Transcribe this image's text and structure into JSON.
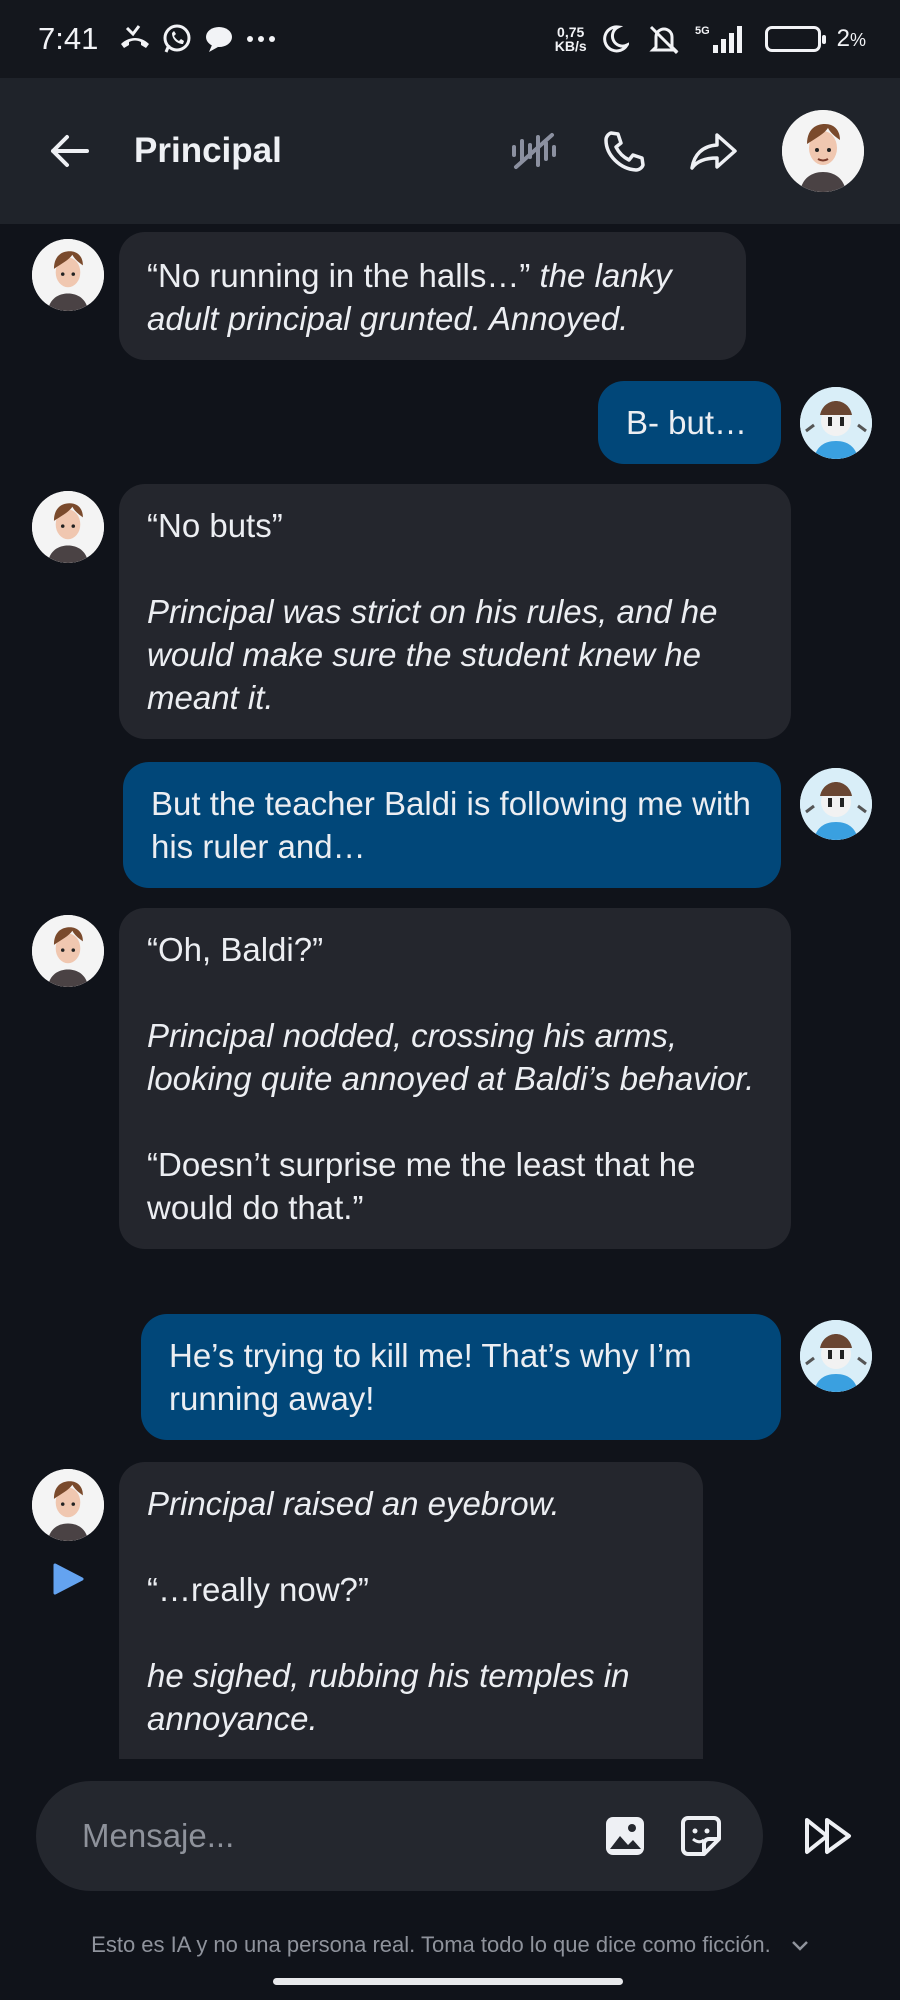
{
  "status_bar": {
    "time": "7:41",
    "icons_left": [
      "missed-call-icon",
      "whatsapp-icon",
      "chat-bubble-icon",
      "more-dots-icon"
    ],
    "speed_value": "0,75",
    "speed_unit": "KB/s",
    "network": "5G",
    "battery": "2",
    "battery_unit": "%"
  },
  "header": {
    "back_icon": "arrow-left-icon",
    "title": "Principal",
    "actions": [
      "voice-off-icon",
      "phone-icon",
      "share-icon"
    ]
  },
  "messages": [
    {
      "sender": "ai",
      "paragraphs": [
        {
          "runs": [
            {
              "text": "“No running in the halls…” ",
              "italic": false
            },
            {
              "text": "the lanky adult principal grunted. Annoyed.",
              "italic": true
            }
          ]
        }
      ]
    },
    {
      "sender": "user",
      "paragraphs": [
        {
          "runs": [
            {
              "text": "B- but…",
              "italic": false
            }
          ]
        }
      ]
    },
    {
      "sender": "ai",
      "paragraphs": [
        {
          "runs": [
            {
              "text": "“No buts”",
              "italic": false
            }
          ]
        },
        {
          "runs": [
            {
              "text": "Principal was strict on his rules, and he would make sure the student knew he meant it.",
              "italic": true
            }
          ]
        }
      ]
    },
    {
      "sender": "user",
      "paragraphs": [
        {
          "runs": [
            {
              "text": "But the teacher Baldi is following me with his ruler and…",
              "italic": false
            }
          ]
        }
      ]
    },
    {
      "sender": "ai",
      "paragraphs": [
        {
          "runs": [
            {
              "text": "“Oh, Baldi?”",
              "italic": false
            }
          ]
        },
        {
          "runs": [
            {
              "text": "Principal nodded, crossing his arms, looking quite annoyed at Baldi’s behavior.",
              "italic": true
            }
          ]
        },
        {
          "runs": [
            {
              "text": "“Doesn’t surprise me the least that he would do that.”",
              "italic": false
            }
          ]
        }
      ]
    },
    {
      "sender": "user",
      "paragraphs": [
        {
          "runs": [
            {
              "text": "He’s trying to kill me! That’s why I’m running away!",
              "italic": false
            }
          ]
        }
      ]
    },
    {
      "sender": "ai",
      "paragraphs": [
        {
          "runs": [
            {
              "text": "Principal raised an eyebrow.",
              "italic": true
            }
          ]
        },
        {
          "runs": [
            {
              "text": "“…really now?”",
              "italic": false
            }
          ]
        },
        {
          "runs": [
            {
              "text": "he sighed, rubbing his temples in annoyance.",
              "italic": true
            }
          ]
        }
      ]
    }
  ],
  "composer": {
    "placeholder": "Mensaje...",
    "icons": [
      "image-icon",
      "sticker-icon"
    ],
    "send_icon": "fast-forward-icon"
  },
  "disclaimer": "Esto es IA y no una persona real. Toma todo lo que dice como ficción."
}
